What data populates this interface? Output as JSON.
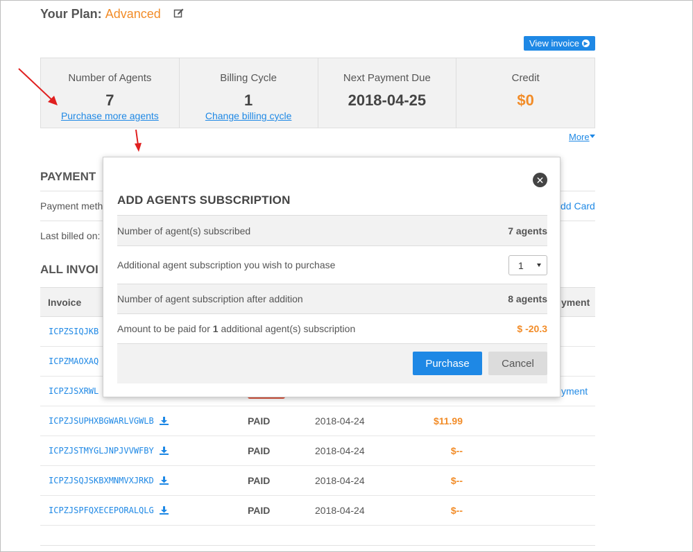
{
  "plan": {
    "label": "Your Plan:",
    "name": "Advanced"
  },
  "view_invoice_label": "View invoice",
  "stats": [
    {
      "label": "Number of Agents",
      "value": "7",
      "link": "Purchase more agents"
    },
    {
      "label": "Billing Cycle",
      "value": "1",
      "link": "Change billing cycle"
    },
    {
      "label": "Next Payment Due",
      "value": "2018-04-25",
      "link": ""
    },
    {
      "label": "Credit",
      "value": "$0",
      "link": ""
    }
  ],
  "more_label": "More",
  "payment": {
    "heading": "PAYMENT",
    "method_label": "Payment meth",
    "add_card": "dd Card",
    "last_billed": "Last billed on:"
  },
  "invoices": {
    "heading": "ALL INVOI",
    "col_invoice": "Invoice",
    "col_payment": "yment",
    "make_payment_link": "yment",
    "rows": [
      {
        "id": "ICPZSIQJKB",
        "status": "",
        "date": "",
        "amount": ""
      },
      {
        "id": "ICPZMAOXAQ",
        "status": "",
        "date": "",
        "amount": ""
      },
      {
        "id": "ICPZJSXRWL",
        "status": "",
        "date": "",
        "amount": ""
      },
      {
        "id": "ICPZJSUPHXBGWARLVGWLB",
        "status": "PAID",
        "date": "2018-04-24",
        "amount": "$11.99"
      },
      {
        "id": "ICPZJSTMYGLJNPJVVWFBY",
        "status": "PAID",
        "date": "2018-04-24",
        "amount": "$--"
      },
      {
        "id": "ICPZJSQJSKBXMNMVXJRKD",
        "status": "PAID",
        "date": "2018-04-24",
        "amount": "$--"
      },
      {
        "id": "ICPZJSPFQXECEPORALQLG",
        "status": "PAID",
        "date": "2018-04-24",
        "amount": "$--"
      }
    ]
  },
  "modal": {
    "title": "ADD AGENTS SUBSCRIPTION",
    "subscribed_label": "Number of agent(s) subscribed",
    "subscribed_value": "7 agents",
    "additional_label": "Additional agent subscription you wish to purchase",
    "additional_selected": "1",
    "after_label": "Number of agent subscription after addition",
    "after_value": "8 agents",
    "amount_label_pre": "Amount to be paid for",
    "amount_label_count": "1",
    "amount_label_post": "additional agent(s) subscription",
    "amount_value": "$ -20.3",
    "purchase_label": "Purchase",
    "cancel_label": "Cancel"
  },
  "colors": {
    "accent": "#1e88e5",
    "highlight": "#f28c28",
    "annotation": "#e02020"
  }
}
